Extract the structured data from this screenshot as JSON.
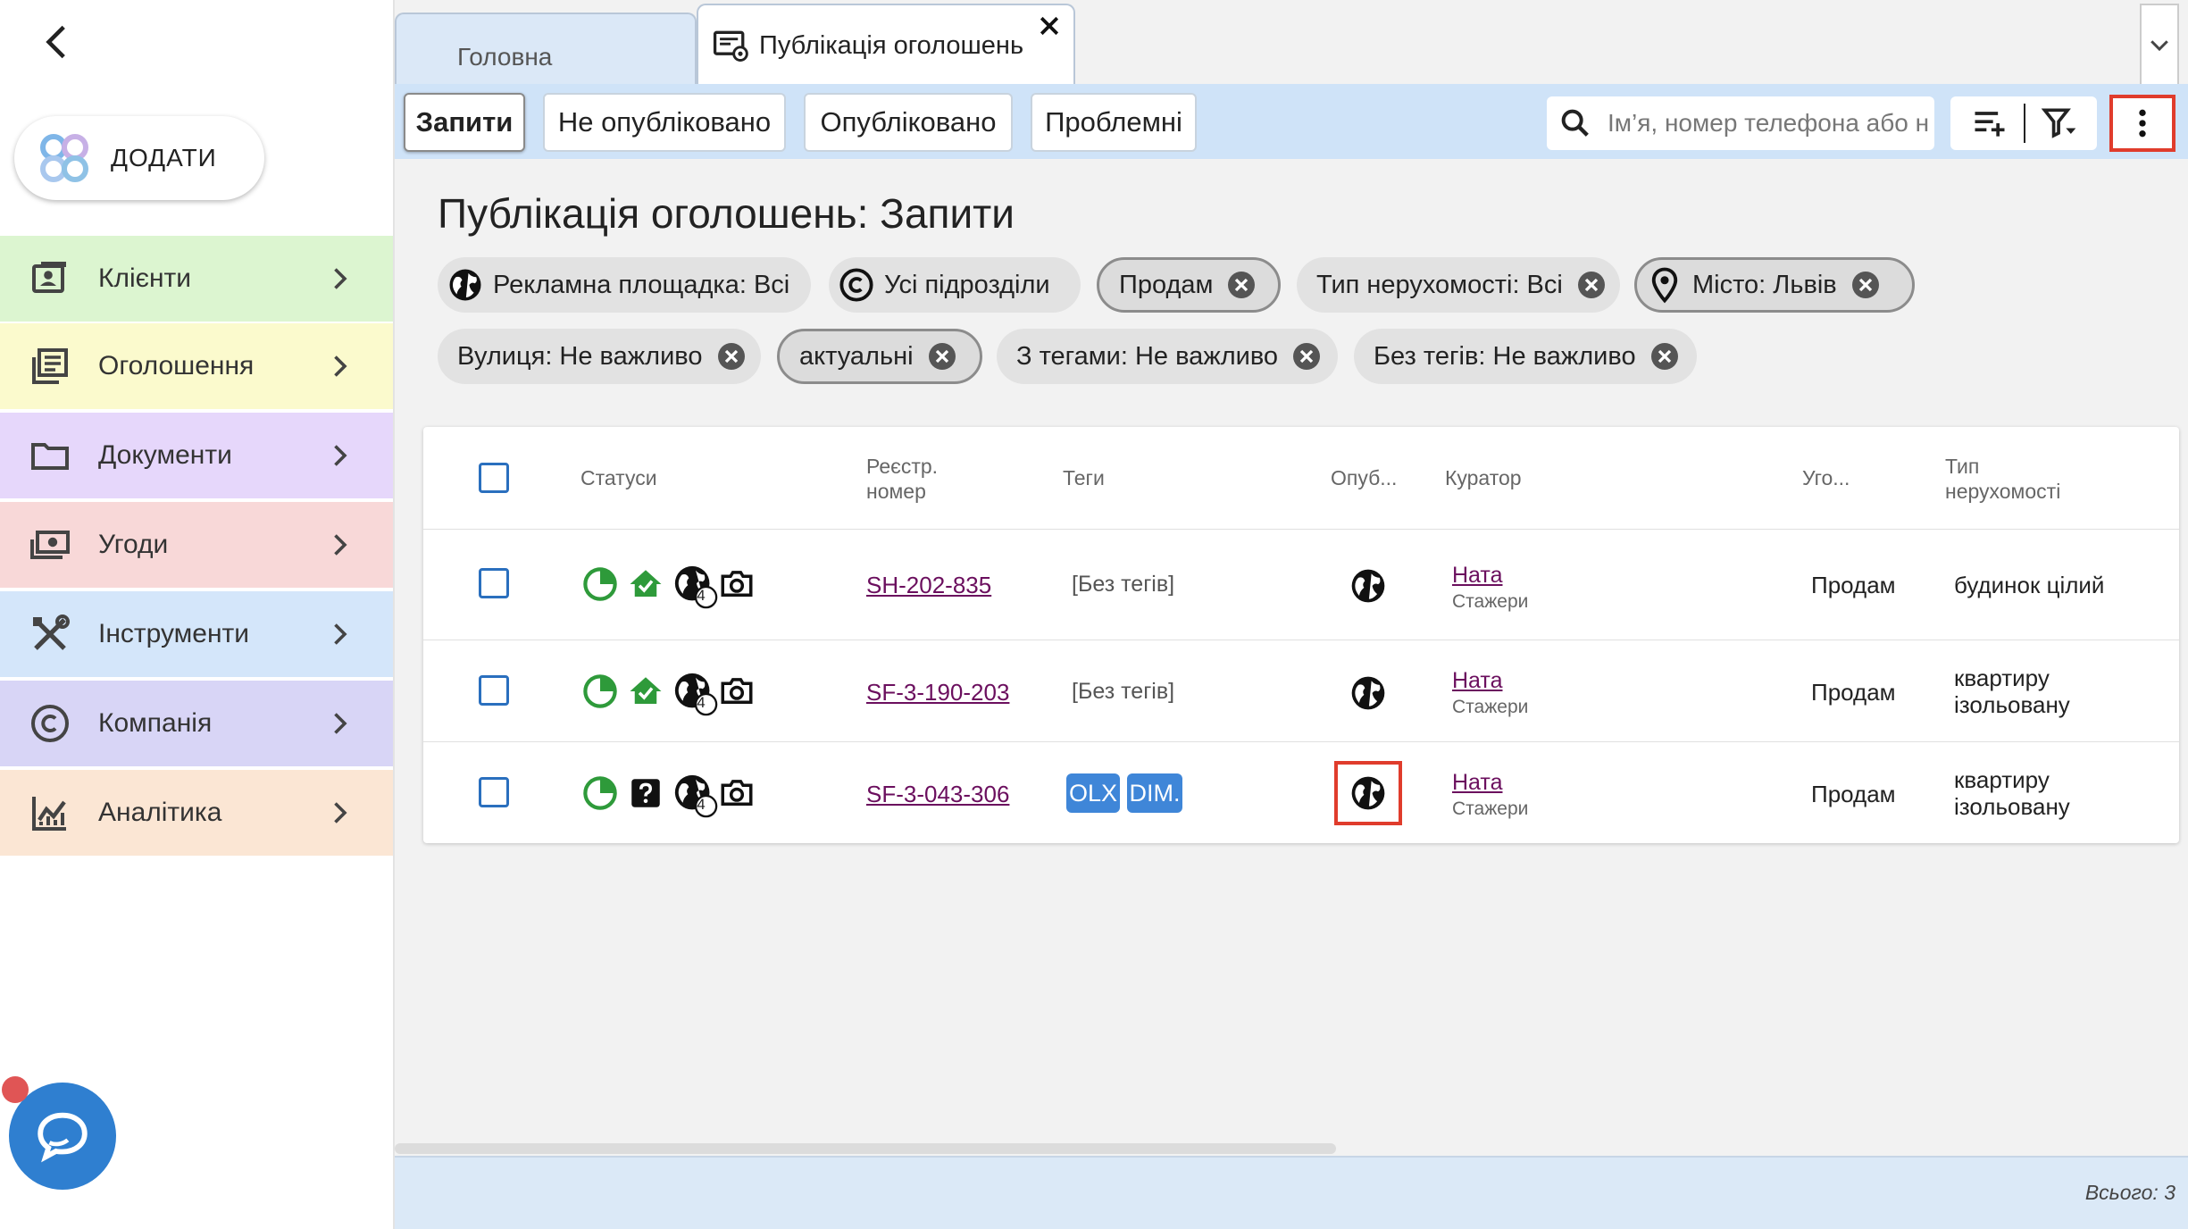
{
  "sidebar": {
    "add_label": "ДОДАТИ",
    "items": [
      {
        "label": "Клієнти",
        "icon": "contacts-icon",
        "bg": "#dcf5d0"
      },
      {
        "label": "Оголошення",
        "icon": "listing-icon",
        "bg": "#fbfacd"
      },
      {
        "label": "Документи",
        "icon": "folder-icon",
        "bg": "#e6d7fb"
      },
      {
        "label": "Угоди",
        "icon": "money-icon",
        "bg": "#f8d8d8"
      },
      {
        "label": "Інструменти",
        "icon": "tools-icon",
        "bg": "#d4e6fa"
      },
      {
        "label": "Компанія",
        "icon": "copyright-icon",
        "bg": "#d8d5f6"
      },
      {
        "label": "Аналітика",
        "icon": "analytics-icon",
        "bg": "#fbe6d4"
      }
    ]
  },
  "tabs": {
    "home": "Головна",
    "publications": "Публікація оголошень"
  },
  "toolbar": {
    "segments": [
      "Запити",
      "Не опубліковано",
      "Опубліковано",
      "Проблемні"
    ],
    "active_segment": "Запити",
    "search_placeholder": "Ім’я, номер телефона або н"
  },
  "page": {
    "title": "Публікація оголошень: Запити"
  },
  "filters": {
    "row1": [
      {
        "label": "Рекламна площадка: Всі",
        "icon": "globe-icon"
      },
      {
        "label": "Усі підрозділи",
        "icon": "copyright-icon"
      },
      {
        "label": "Продам"
      },
      {
        "label": "Тип нерухомості: Всі"
      },
      {
        "label": "Місто: Львів",
        "icon": "location-pin-icon"
      }
    ],
    "row2": [
      {
        "label": "Вулиця: Не важливо"
      },
      {
        "label": "актуальні"
      },
      {
        "label": "З тегами: Не важливо"
      },
      {
        "label": "Без тегів: Не важливо"
      }
    ]
  },
  "table": {
    "headers": {
      "statuses": "Статуси",
      "reg_line1": "Реєстр.",
      "reg_line2": "номер",
      "tags": "Теги",
      "published": "Опуб...",
      "curator": "Куратор",
      "deal": "Уго...",
      "ptype_line1": "Тип",
      "ptype_line2": "нерухомості"
    },
    "rows": [
      {
        "reg": "SH-202-835",
        "tags_text": "[Без тегів]",
        "curator": "Ната",
        "curator_sub": "Стажери",
        "deal": "Продам",
        "ptype1": "будинок цілий",
        "ptype2": "",
        "second_status": "house-icon",
        "globe_badge": "4"
      },
      {
        "reg": "SF-3-190-203",
        "tags_text": "[Без тегів]",
        "curator": "Ната",
        "curator_sub": "Стажери",
        "deal": "Продам",
        "ptype1": "квартиру",
        "ptype2": "ізольовану",
        "second_status": "house-icon",
        "globe_badge": "4"
      },
      {
        "reg": "SF-3-043-306",
        "tags": [
          "OLX",
          "DIM."
        ],
        "curator": "Ната",
        "curator_sub": "Стажери",
        "deal": "Продам",
        "ptype1": "квартиру",
        "ptype2": "ізольовану",
        "second_status": "question-icon",
        "globe_badge": "4"
      }
    ]
  },
  "footer": {
    "total": "Всього: 3"
  },
  "colors": {
    "accent_blue": "#2a6fbe",
    "status_green": "#2e9a3a",
    "highlight_red": "#e03c2c",
    "link_purple": "#6b0f5e"
  }
}
